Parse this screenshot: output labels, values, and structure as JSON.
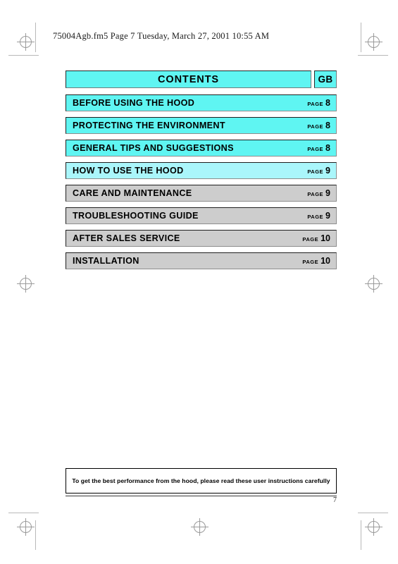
{
  "document": {
    "running_header": "75004Agb.fm5  Page 7  Tuesday, March 27, 2001  10:55 AM",
    "page_number": "7"
  },
  "contents": {
    "title": "CONTENTS",
    "language_code": "GB",
    "page_word": "PAGE",
    "rows": [
      {
        "label": "BEFORE USING THE HOOD",
        "page": "8",
        "style": "cyan"
      },
      {
        "label": "PROTECTING THE ENVIRONMENT",
        "page": "8",
        "style": "cyan"
      },
      {
        "label": "GENERAL TIPS AND SUGGESTIONS",
        "page": "8",
        "style": "cyan"
      },
      {
        "label": "HOW TO USE THE HOOD",
        "page": "9",
        "style": "cyan-light"
      },
      {
        "label": "CARE AND MAINTENANCE",
        "page": "9",
        "style": "gray"
      },
      {
        "label": "TROUBLESHOOTING GUIDE",
        "page": "9",
        "style": "gray"
      },
      {
        "label": "AFTER SALES SERVICE",
        "page": "10",
        "style": "gray"
      },
      {
        "label": "INSTALLATION",
        "page": "10",
        "style": "gray"
      }
    ]
  },
  "footer_note": {
    "text": "To get the best performance from the hood, please read these user instructions carefully"
  },
  "colors": {
    "cyan": "#5ff5f2",
    "cyan_light": "#aaf6fb",
    "gray": "#cdcdcd",
    "border": "#1f1f1f"
  }
}
